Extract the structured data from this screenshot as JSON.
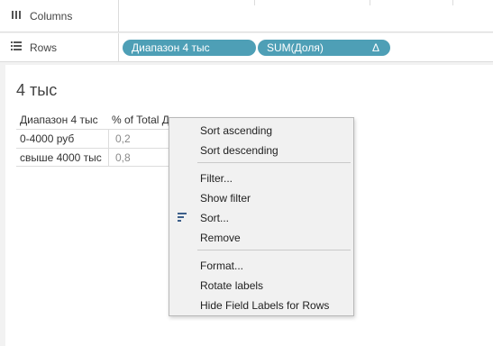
{
  "shelves": {
    "columns": {
      "label": "Columns",
      "icon": "columns-icon"
    },
    "rows": {
      "label": "Rows",
      "icon": "rows-icon"
    },
    "pills": [
      {
        "label": "Диапазон 4 тыс",
        "color": "#4e9fb6"
      },
      {
        "label": "SUM(Доля)",
        "marker": "Δ",
        "color": "#4e9fb6"
      }
    ]
  },
  "sheet": {
    "title": "4 тыс",
    "table": {
      "headers": [
        "Диапазон 4 тыс",
        "% of Total Д"
      ],
      "rows": [
        {
          "label": "0-4000 руб",
          "value": "0,2"
        },
        {
          "label": "свыше 4000 тыс",
          "value": "0,8"
        }
      ]
    }
  },
  "context_menu": {
    "items": [
      "Sort ascending",
      "Sort descending",
      "Filter...",
      "Show filter",
      "Sort...",
      "Remove",
      "Format...",
      "Rotate labels",
      "Hide Field Labels for Rows"
    ],
    "sort_icon": "sort-icon"
  },
  "colors": {
    "pill": "#4e9fb6",
    "background": "#f2f2f2",
    "menu": "#f1f1f1"
  }
}
